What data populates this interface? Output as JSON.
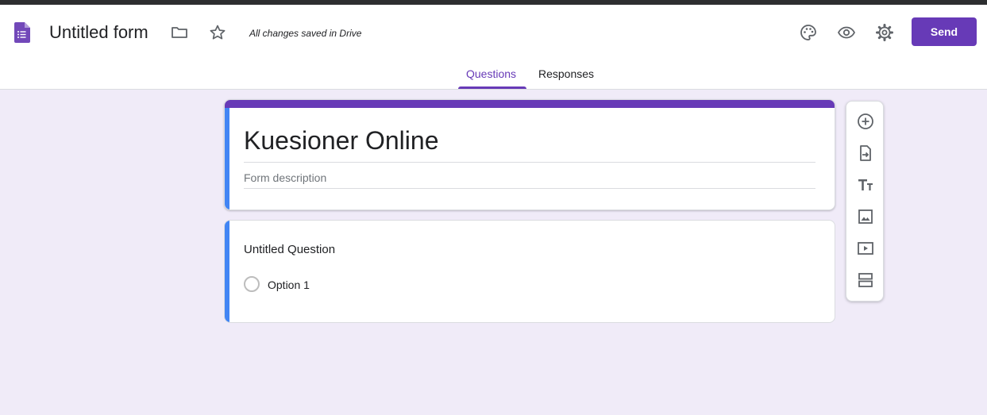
{
  "header": {
    "doc_title": "Untitled form",
    "save_status": "All changes saved in Drive",
    "send_label": "Send"
  },
  "tabs": [
    {
      "label": "Questions",
      "active": true
    },
    {
      "label": "Responses",
      "active": false
    }
  ],
  "form": {
    "title": "Kuesioner Online",
    "description_placeholder": "Form description"
  },
  "question": {
    "title": "Untitled Question",
    "options": [
      "Option 1"
    ]
  },
  "icons": {
    "header": [
      "forms-logo-icon",
      "folder-icon",
      "star-icon",
      "palette-icon",
      "eye-icon",
      "gear-icon"
    ],
    "toolbar": [
      "add-question-icon",
      "import-questions-icon",
      "title-text-icon",
      "image-icon",
      "video-icon",
      "section-icon"
    ]
  },
  "colors": {
    "accent": "#673ab7",
    "question_accent": "#4285f4",
    "background": "#f0ebf8"
  }
}
